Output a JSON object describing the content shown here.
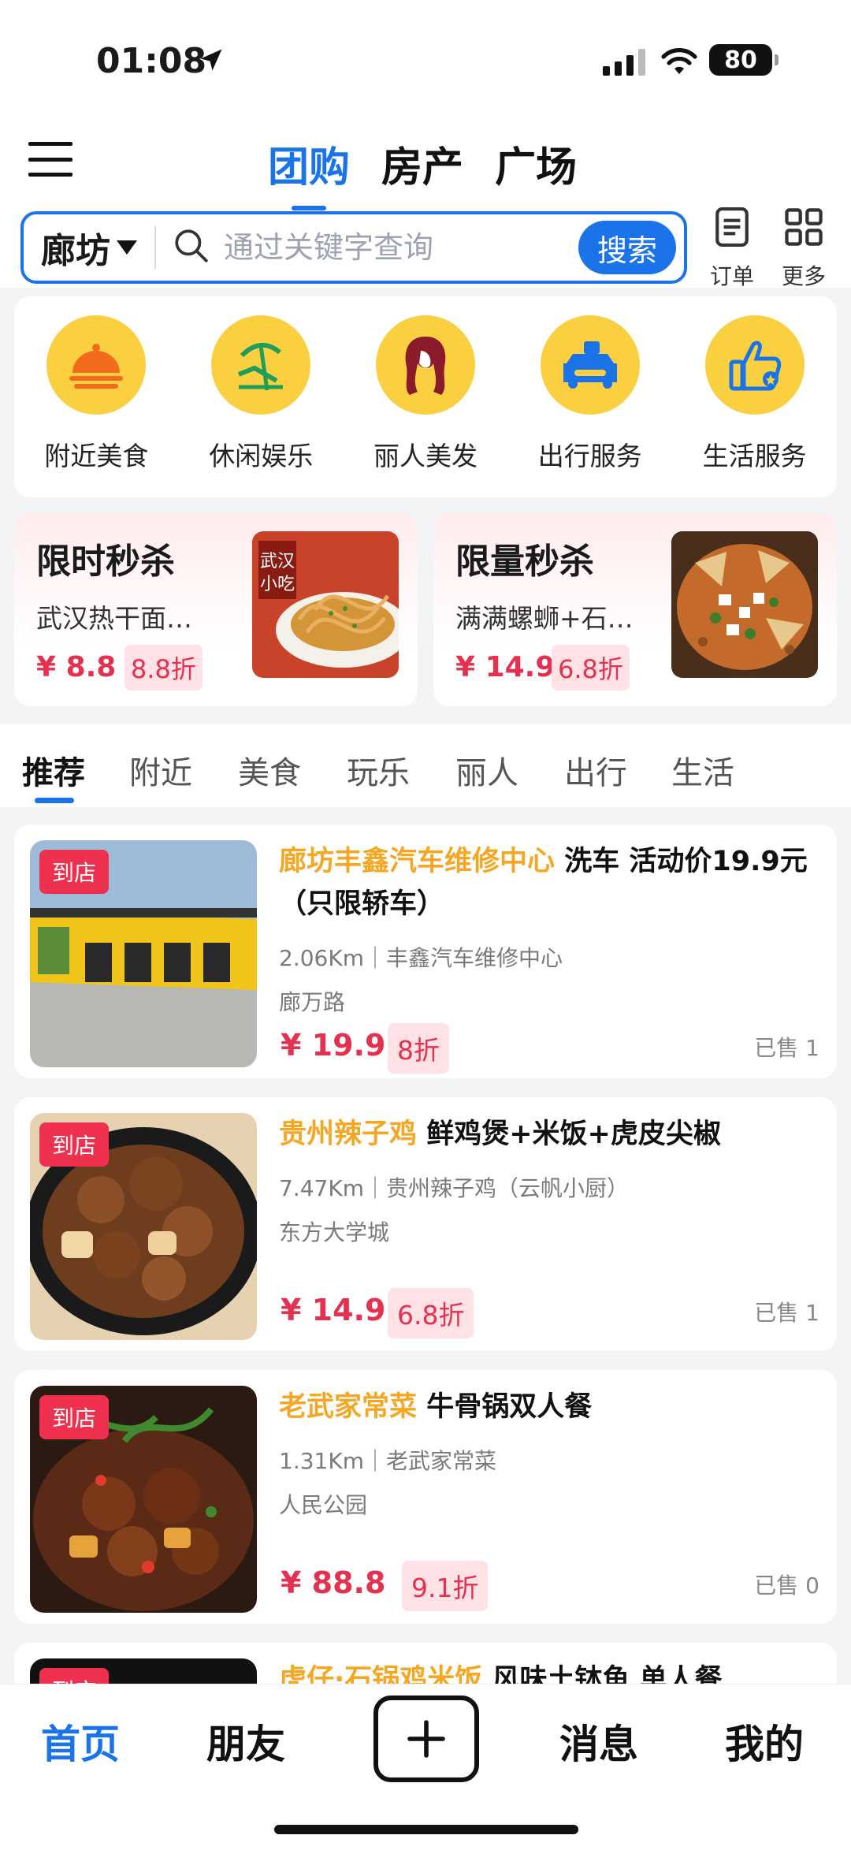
{
  "status": {
    "time": "01:08",
    "battery": "80"
  },
  "header": {
    "tabs": [
      {
        "label": "团购"
      },
      {
        "label": "房产"
      },
      {
        "label": "广场"
      }
    ],
    "city": "廊坊",
    "search_placeholder": "通过关键字查询",
    "search_button": "搜索",
    "orders_label": "订单",
    "more_label": "更多"
  },
  "categories": [
    {
      "label": "附近美食",
      "icon": "food-cloche-icon"
    },
    {
      "label": "休闲娱乐",
      "icon": "beach-chair-icon"
    },
    {
      "label": "丽人美发",
      "icon": "woman-hair-icon"
    },
    {
      "label": "出行服务",
      "icon": "car-service-icon"
    },
    {
      "label": "生活服务",
      "icon": "thumbs-up-icon"
    }
  ],
  "flash": [
    {
      "title": "限时秒杀",
      "desc": "武汉热干面…",
      "price": "¥ 8.8",
      "discount": "8.8折",
      "img_text": "武汉小吃"
    },
    {
      "title": "限量秒杀",
      "desc": "满满螺蛳+石…",
      "price": "¥ 14.9",
      "discount": "6.8折"
    }
  ],
  "filters": [
    "推荐",
    "附近",
    "美食",
    "玩乐",
    "丽人",
    "出行",
    "生活"
  ],
  "deals": [
    {
      "tag": "到店",
      "store": "廊坊丰鑫汽车维修中心",
      "name": "洗车 活动价19.9元（只限轿车）",
      "distance": "2.06Km｜丰鑫汽车维修中心",
      "address": "廊万路",
      "price": "¥ 19.9",
      "discount": "8折",
      "sold": "已售 1"
    },
    {
      "tag": "到店",
      "store": "贵州辣子鸡",
      "name": "鲜鸡煲+米饭+虎皮尖椒",
      "distance": "7.47Km｜贵州辣子鸡（云帆小厨）",
      "address": "东方大学城",
      "price": "¥ 14.9",
      "discount": "6.8折",
      "sold": "已售 1"
    },
    {
      "tag": "到店",
      "store": "老武家常菜",
      "name": "牛骨锅双人餐",
      "distance": "1.31Km｜老武家常菜",
      "address": "人民公园",
      "price": "¥ 88.8",
      "discount": "9.1折",
      "sold": "已售 0"
    },
    {
      "tag": "到店",
      "store": "虎仔·石锅鸡米饭",
      "name": "风味土钵鱼 单人餐"
    }
  ],
  "nav": {
    "home": "首页",
    "friends": "朋友",
    "messages": "消息",
    "mine": "我的"
  },
  "colors": {
    "primary": "#1a73e8",
    "price": "#e53150",
    "store": "#f5a623",
    "category_bg": "#fbd040",
    "tag": "#f0304f"
  }
}
